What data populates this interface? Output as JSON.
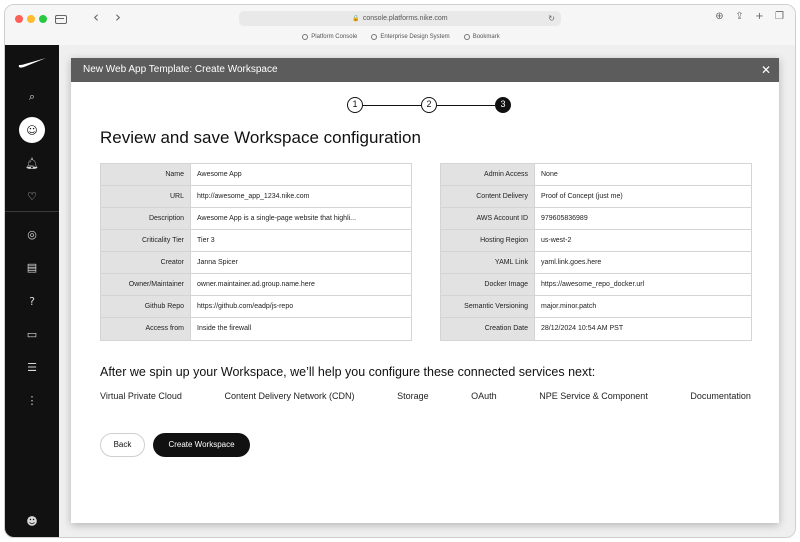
{
  "browser": {
    "url": "console.platforms.nike.com",
    "bookmarks": [
      "Platform Console",
      "Enterprise Design System",
      "Bookmark"
    ]
  },
  "sidebar": {
    "logo": "nike-swoosh",
    "icons": [
      "search-icon",
      "user-icon",
      "bell-icon",
      "heart-icon",
      "compass-icon",
      "document-icon",
      "help-icon",
      "chat-icon",
      "list-icon",
      "more-icon",
      "profile-icon"
    ]
  },
  "modal": {
    "header_title": "New Web App Template: Create Workspace",
    "steps": [
      "1",
      "2",
      "3"
    ],
    "current_step": 3,
    "title": "Review and save Workspace configuration",
    "left_rows": [
      {
        "label": "Name",
        "value": "Awesome App"
      },
      {
        "label": "URL",
        "value": "http://awesome_app_1234.nike.com"
      },
      {
        "label": "Description",
        "value": "Awesome App is a single-page website that highli..."
      },
      {
        "label": "Criticality Tier",
        "value": "Tier 3"
      },
      {
        "label": "Creator",
        "value": "Janna Spicer"
      },
      {
        "label": "Owner/Maintainer",
        "value": "owner.maintainer.ad.group.name.here"
      },
      {
        "label": "Github Repo",
        "value": "https://github.com/eadp/js-repo"
      },
      {
        "label": "Access from",
        "value": "Inside the firewall"
      }
    ],
    "right_rows": [
      {
        "label": "Admin Access",
        "value": "None"
      },
      {
        "label": "Content Delivery",
        "value": "Proof of Concept (just me)"
      },
      {
        "label": "AWS Account ID",
        "value": "979605836989"
      },
      {
        "label": "Hosting Region",
        "value": "us-west-2"
      },
      {
        "label": "YAML Link",
        "value": "yaml.link.goes.here"
      },
      {
        "label": "Docker Image",
        "value": "https://awesome_repo_docker.url"
      },
      {
        "label": "Semantic Versioning",
        "value": "major.minor.patch"
      },
      {
        "label": "Creation Date",
        "value": "28/12/2024 10:54 AM PST"
      }
    ],
    "services_heading": "After we spin up your Workspace, we’ll help you configure these connected services next:",
    "services": [
      "Virtual Private Cloud",
      "Content Delivery Network (CDN)",
      "Storage",
      "OAuth",
      "NPE Service & Component",
      "Documentation"
    ],
    "back_label": "Back",
    "create_label": "Create Workspace"
  }
}
